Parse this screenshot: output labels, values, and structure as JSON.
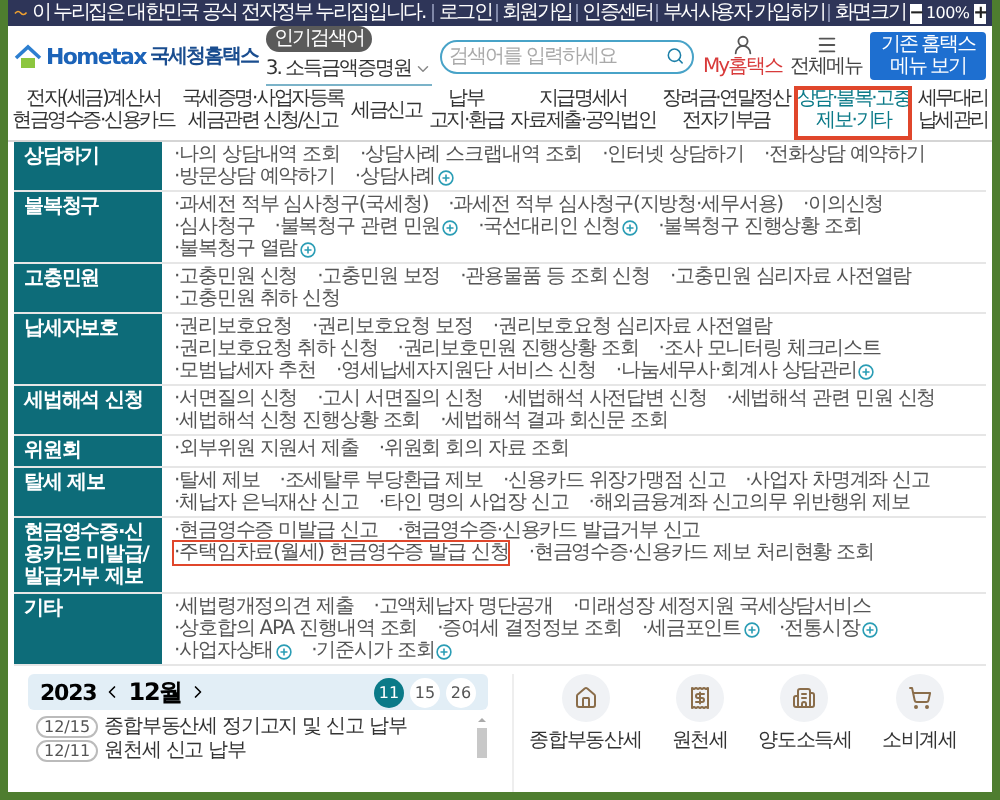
{
  "gov_banner": {
    "text": "이 누리집은 대한민국 공식 전자정부 누리집입니다."
  },
  "util_links": [
    "로그인",
    "회원가입",
    "인증센터",
    "부서사용자 가입하기",
    "화면크기"
  ],
  "zoom": {
    "minus": "−",
    "value": "100%",
    "plus": "+"
  },
  "logo": {
    "name": "Hometax",
    "subtitle": "국세청홈택스"
  },
  "popular_search": {
    "badge": "인기검색어",
    "keyword": "3. 소득금액증명원"
  },
  "search": {
    "placeholder": "검색어를 입력하세요"
  },
  "my_hometax": "My홈택스",
  "all_menu": "전체메뉴",
  "classic_button": "기존 홈택스 메뉴 보기",
  "nav": [
    {
      "lines": [
        "전자(세금)계산서",
        "현금영수증·신용카드"
      ],
      "selected": false,
      "highlighted": false
    },
    {
      "lines": [
        "국세증명·사업자등록",
        "세금관련 신청/신고"
      ],
      "selected": false,
      "highlighted": false
    },
    {
      "lines": [
        "세금신고"
      ],
      "selected": false,
      "highlighted": false
    },
    {
      "lines": [
        "납부",
        "고지·환급"
      ],
      "selected": false,
      "highlighted": false
    },
    {
      "lines": [
        "지급명세서",
        "자료제출·공익법인"
      ],
      "selected": false,
      "highlighted": false
    },
    {
      "lines": [
        "장려금·연말정산",
        "전자기부금"
      ],
      "selected": false,
      "highlighted": false
    },
    {
      "lines": [
        "상담·불복·고충",
        "제보·기타"
      ],
      "selected": true,
      "highlighted": true
    },
    {
      "lines": [
        "세무대리",
        "납세관리"
      ],
      "selected": false,
      "highlighted": false
    }
  ],
  "mega_menu": [
    {
      "category": "상담하기",
      "items": [
        {
          "label": "·나의 상담내역 조회",
          "more": false,
          "highlighted": false
        },
        {
          "label": "·상담사례 스크랩내역 조회",
          "more": false,
          "highlighted": false
        },
        {
          "label": "·인터넷 상담하기",
          "more": false,
          "highlighted": false
        },
        {
          "label": "·전화상담 예약하기",
          "more": false,
          "highlighted": false
        },
        {
          "label": "·방문상담 예약하기",
          "more": false,
          "highlighted": false
        },
        {
          "label": "·상담사례",
          "more": true,
          "highlighted": false
        }
      ]
    },
    {
      "category": "불복청구",
      "items": [
        {
          "label": "·과세전 적부 심사청구(국세청)",
          "more": false,
          "highlighted": false
        },
        {
          "label": "·과세전 적부 심사청구(지방청·세무서용)",
          "more": false,
          "highlighted": false
        },
        {
          "label": "·이의신청",
          "more": false,
          "highlighted": false
        },
        {
          "label": "·심사청구",
          "more": false,
          "highlighted": false
        },
        {
          "label": "·불복청구 관련 민원",
          "more": true,
          "highlighted": false
        },
        {
          "label": "·국선대리인 신청",
          "more": true,
          "highlighted": false
        },
        {
          "label": "·불복청구 진행상황 조회",
          "more": false,
          "highlighted": false
        },
        {
          "label": "·불복청구 열람",
          "more": true,
          "highlighted": false
        }
      ]
    },
    {
      "category": "고충민원",
      "items": [
        {
          "label": "·고충민원 신청",
          "more": false,
          "highlighted": false
        },
        {
          "label": "·고충민원 보정",
          "more": false,
          "highlighted": false
        },
        {
          "label": "·관용물품 등 조회 신청",
          "more": false,
          "highlighted": false
        },
        {
          "label": "·고충민원 심리자료 사전열람",
          "more": false,
          "highlighted": false
        },
        {
          "label": "·고충민원 취하 신청",
          "more": false,
          "highlighted": false
        }
      ]
    },
    {
      "category": "납세자보호",
      "items": [
        {
          "label": "·권리보호요청",
          "more": false,
          "highlighted": false
        },
        {
          "label": "·권리보호요청 보정",
          "more": false,
          "highlighted": false
        },
        {
          "label": "·권리보호요청 심리자료 사전열람",
          "more": false,
          "highlighted": false
        },
        {
          "label": "·권리보호요청 취하 신청",
          "more": false,
          "highlighted": false
        },
        {
          "label": "·권리보호민원 진행상황 조회",
          "more": false,
          "highlighted": false
        },
        {
          "label": "·조사 모니터링 체크리스트",
          "more": false,
          "highlighted": false
        },
        {
          "label": "·모범납세자 추천",
          "more": false,
          "highlighted": false
        },
        {
          "label": "·영세납세자지원단 서비스 신청",
          "more": false,
          "highlighted": false
        },
        {
          "label": "·나눔세무사·회계사 상담관리",
          "more": true,
          "highlighted": false
        }
      ]
    },
    {
      "category": "세법해석 신청",
      "items": [
        {
          "label": "·서면질의 신청",
          "more": false,
          "highlighted": false
        },
        {
          "label": "·고시 서면질의 신청",
          "more": false,
          "highlighted": false
        },
        {
          "label": "·세법해석 사전답변 신청",
          "more": false,
          "highlighted": false
        },
        {
          "label": "·세법해석 관련 민원 신청",
          "more": false,
          "highlighted": false
        },
        {
          "label": "·세법해석 신청 진행상황 조회",
          "more": false,
          "highlighted": false
        },
        {
          "label": "·세법해석 결과 회신문 조회",
          "more": false,
          "highlighted": false
        }
      ]
    },
    {
      "category": "위원회",
      "items": [
        {
          "label": "·외부위원 지원서 제출",
          "more": false,
          "highlighted": false
        },
        {
          "label": "·위원회 회의 자료 조회",
          "more": false,
          "highlighted": false
        }
      ]
    },
    {
      "category": "탈세 제보",
      "items": [
        {
          "label": "·탈세 제보",
          "more": false,
          "highlighted": false
        },
        {
          "label": "·조세탈루 부당환급 제보",
          "more": false,
          "highlighted": false
        },
        {
          "label": "·신용카드 위장가맹점 신고",
          "more": false,
          "highlighted": false
        },
        {
          "label": "·사업자 차명계좌 신고",
          "more": false,
          "highlighted": false
        },
        {
          "label": "·체납자 은닉재산 신고",
          "more": false,
          "highlighted": false
        },
        {
          "label": "·타인 명의 사업장 신고",
          "more": false,
          "highlighted": false
        },
        {
          "label": "·해외금융계좌 신고의무 위반행위 제보",
          "more": false,
          "highlighted": false
        }
      ]
    },
    {
      "category": "현금영수증·신용카드 미발급/발급거부 제보",
      "items": [
        {
          "label": "·현금영수증 미발급 신고",
          "more": false,
          "highlighted": false
        },
        {
          "label": "·현금영수증·신용카드 발급거부 신고",
          "more": false,
          "highlighted": false
        },
        {
          "label": "·주택임차료(월세) 현금영수증 발급 신청",
          "more": false,
          "highlighted": true
        },
        {
          "label": "·현금영수증·신용카드 제보 처리현황 조회",
          "more": false,
          "highlighted": false
        }
      ]
    },
    {
      "category": "기타",
      "items": [
        {
          "label": "·세법령개정의견 제출",
          "more": false,
          "highlighted": false
        },
        {
          "label": "·고액체납자 명단공개",
          "more": false,
          "highlighted": false
        },
        {
          "label": "·미래성장 세정지원 국세상담서비스",
          "more": false,
          "highlighted": false
        },
        {
          "label": "·상호합의 APA 진행내역 조회",
          "more": false,
          "highlighted": false
        },
        {
          "label": "·증여세 결정정보 조회",
          "more": false,
          "highlighted": false
        },
        {
          "label": "·세금포인트",
          "more": true,
          "highlighted": false
        },
        {
          "label": "·전통시장",
          "more": true,
          "highlighted": false
        },
        {
          "label": "·사업자상태",
          "more": true,
          "highlighted": false
        },
        {
          "label": "·기준시가 조회",
          "more": true,
          "highlighted": false
        }
      ]
    }
  ],
  "calendar": {
    "year": "2023",
    "month": "12월",
    "days": [
      {
        "label": "11",
        "selected": true
      },
      {
        "label": "15",
        "selected": false
      },
      {
        "label": "26",
        "selected": false
      }
    ],
    "events": [
      {
        "date": "12/15",
        "title": "종합부동산세 정기고지 및 신고 납부"
      },
      {
        "date": "12/11",
        "title": "원천세 신고 납부"
      }
    ]
  },
  "quick_taxes": [
    {
      "label": "종합부동산세"
    },
    {
      "label": "원천세"
    },
    {
      "label": "양도소득세"
    },
    {
      "label": "소비계세"
    }
  ]
}
